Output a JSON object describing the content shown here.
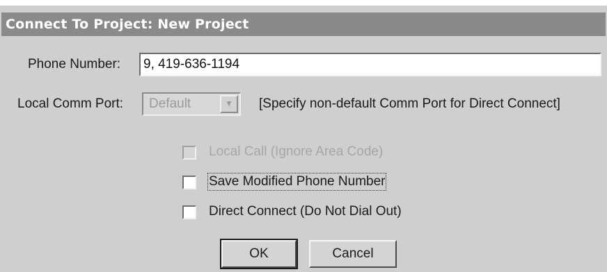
{
  "window": {
    "title": "Connect To Project: New Project"
  },
  "phone": {
    "label": "Phone Number:",
    "value": "9, 419-636-1194"
  },
  "comm_port": {
    "label": "Local Comm Port:",
    "selected": "Default",
    "hint": "[Specify non-default Comm Port for Direct Connect]",
    "enabled": false
  },
  "options": [
    {
      "label": "Local Call (Ignore Area Code)",
      "checked": false,
      "enabled": false
    },
    {
      "label": "Save Modified Phone Number",
      "checked": false,
      "enabled": true
    },
    {
      "label": "Direct Connect (Do Not Dial Out)",
      "checked": false,
      "enabled": true
    }
  ],
  "buttons": {
    "ok": "OK",
    "cancel": "Cancel"
  },
  "colors": {
    "title_bar": "#8a8a8a",
    "dialog_bg": "#cfcfcf"
  }
}
